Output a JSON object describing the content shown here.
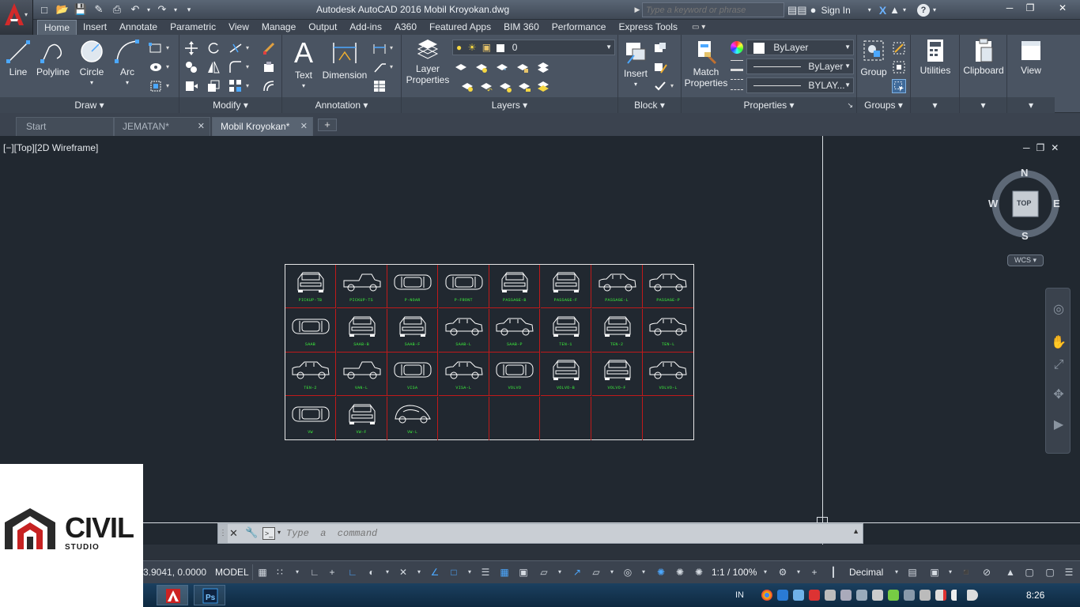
{
  "window": {
    "title": "Autodesk AutoCAD 2016    Mobil Kroyokan.dwg",
    "search_placeholder": "Type a keyword or phrase",
    "sign_in": "Sign In"
  },
  "ribbon_tabs": [
    "Home",
    "Insert",
    "Annotate",
    "Parametric",
    "View",
    "Manage",
    "Output",
    "Add-ins",
    "A360",
    "Featured Apps",
    "BIM 360",
    "Performance",
    "Express Tools"
  ],
  "ribbon": {
    "draw": {
      "title": "Draw",
      "line": "Line",
      "polyline": "Polyline",
      "circle": "Circle",
      "arc": "Arc"
    },
    "modify": {
      "title": "Modify"
    },
    "annotation": {
      "title": "Annotation",
      "text": "Text",
      "dimension": "Dimension"
    },
    "layers": {
      "title": "Layers",
      "layer_properties_1": "Layer",
      "layer_properties_2": "Properties",
      "current_layer": "0"
    },
    "block": {
      "title": "Block",
      "insert": "Insert"
    },
    "properties": {
      "title": "Properties",
      "match_1": "Match",
      "match_2": "Properties",
      "color": "ByLayer",
      "linetype": "ByLayer",
      "lineweight": "BYLAY..."
    },
    "groups": {
      "title": "Groups",
      "group": "Group"
    },
    "utilities": {
      "label": "Utilities"
    },
    "clipboard": {
      "label": "Clipboard"
    },
    "view": {
      "label": "View"
    }
  },
  "doc_tabs": [
    {
      "label": "Start"
    },
    {
      "label": "JEMATAN*"
    },
    {
      "label": "Mobil Kroyokan*"
    }
  ],
  "viewport": {
    "label": "[−][Top][2D Wireframe]",
    "viewcube": {
      "n": "N",
      "s": "S",
      "e": "E",
      "w": "W",
      "top": "TOP"
    },
    "wcs": "WCS"
  },
  "drawing": {
    "rows": [
      [
        "PICKUP-TB",
        "PICKUP-TS",
        "P-NOAR",
        "P-FRONT",
        "PASSAGE-B",
        "PASSAGE-F",
        "PASSAGE-L",
        "PASSAGE-P"
      ],
      [
        "SAAB",
        "SAAB-B",
        "SAAB-F",
        "SAAB-L",
        "SAAB-P",
        "TEN-1",
        "TEN-2",
        "TEN-L"
      ],
      [
        "TEN-2",
        "VAN-L",
        "VISA",
        "VISA-L",
        "VOLVO",
        "VOLVO-B",
        "VOLVO-F",
        "VOLVO-L"
      ],
      [
        "VW",
        "VW-F",
        "VW-L",
        "",
        "",
        "",
        "",
        ""
      ]
    ]
  },
  "command_line": {
    "placeholder": "Type  a  command"
  },
  "status": {
    "coords": "3.9041, 0.0000",
    "model": "MODEL",
    "scale": "1:1 / 100%",
    "units": "Decimal"
  },
  "taskbar": {
    "lang": "IN",
    "clock": "8:26"
  },
  "watermark": {
    "text_1": "CIVIL",
    "text_2": "STUDIO"
  }
}
